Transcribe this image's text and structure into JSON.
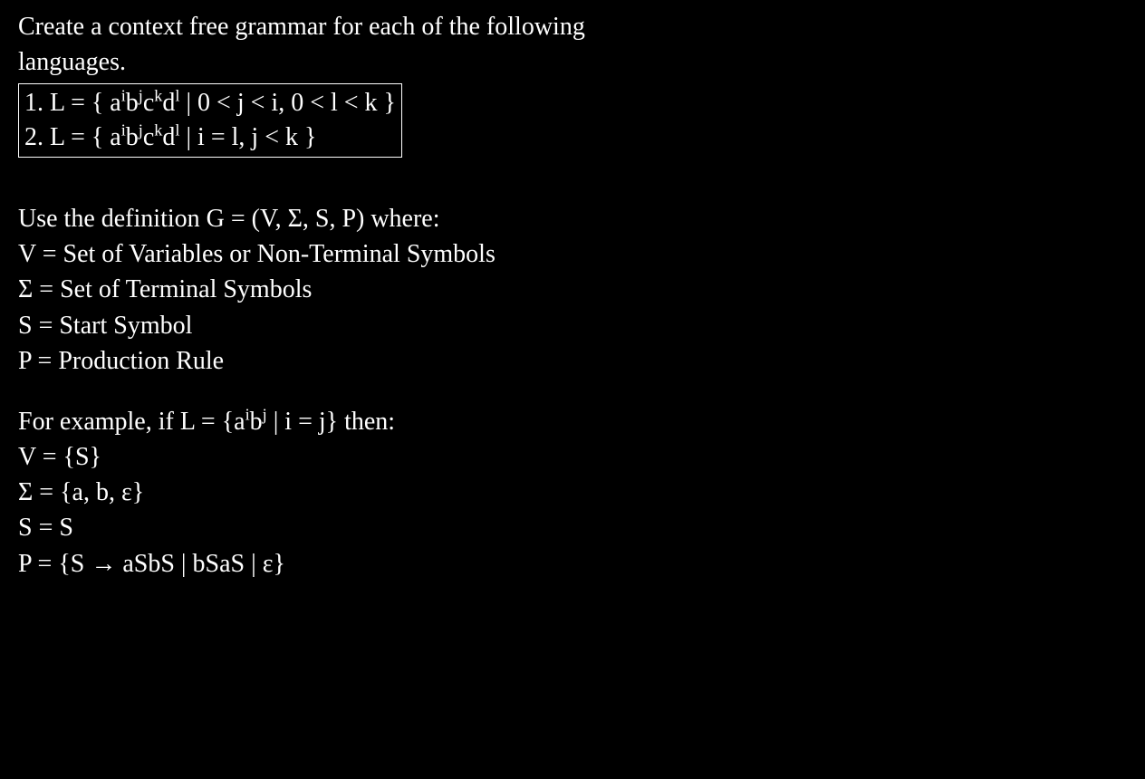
{
  "intro": {
    "line1": "Create a context free grammar for each of the following",
    "line2": "languages."
  },
  "problems": {
    "p1_prefix": "1. L = { a",
    "p1_sup1": "i",
    "p1_b": "b",
    "p1_sup2": "j",
    "p1_c": "c",
    "p1_sup3": "k",
    "p1_d": "d",
    "p1_sup4": "l",
    "p1_bar": " |   0 < j < i, 0 < l < k }",
    "p2_prefix": "2. L = { a",
    "p2_sup1": "i",
    "p2_b": "b",
    "p2_sup2": "j",
    "p2_c": "c",
    "p2_sup3": "k",
    "p2_d": "d",
    "p2_sup4": "l",
    "p2_bar": " |   i = l, j < k }"
  },
  "definition": {
    "header": "Use the definition G = (V, Σ, S, P) where:",
    "v": "V = Set of Variables or Non-Terminal Symbols",
    "sigma": "Σ = Set of Terminal Symbols",
    "s": "S = Start Symbol",
    "p": "P = Production Rule"
  },
  "example": {
    "header_prefix": "For example, if L = {a",
    "header_sup1": "i",
    "header_b": "b",
    "header_sup2": "j",
    "header_suffix": " | i = j} then:",
    "v": "V = {S}",
    "sigma": "Σ = {a, b, ε}",
    "s": "S = S",
    "p": "P = {S → aSbS | bSaS | ε}"
  }
}
